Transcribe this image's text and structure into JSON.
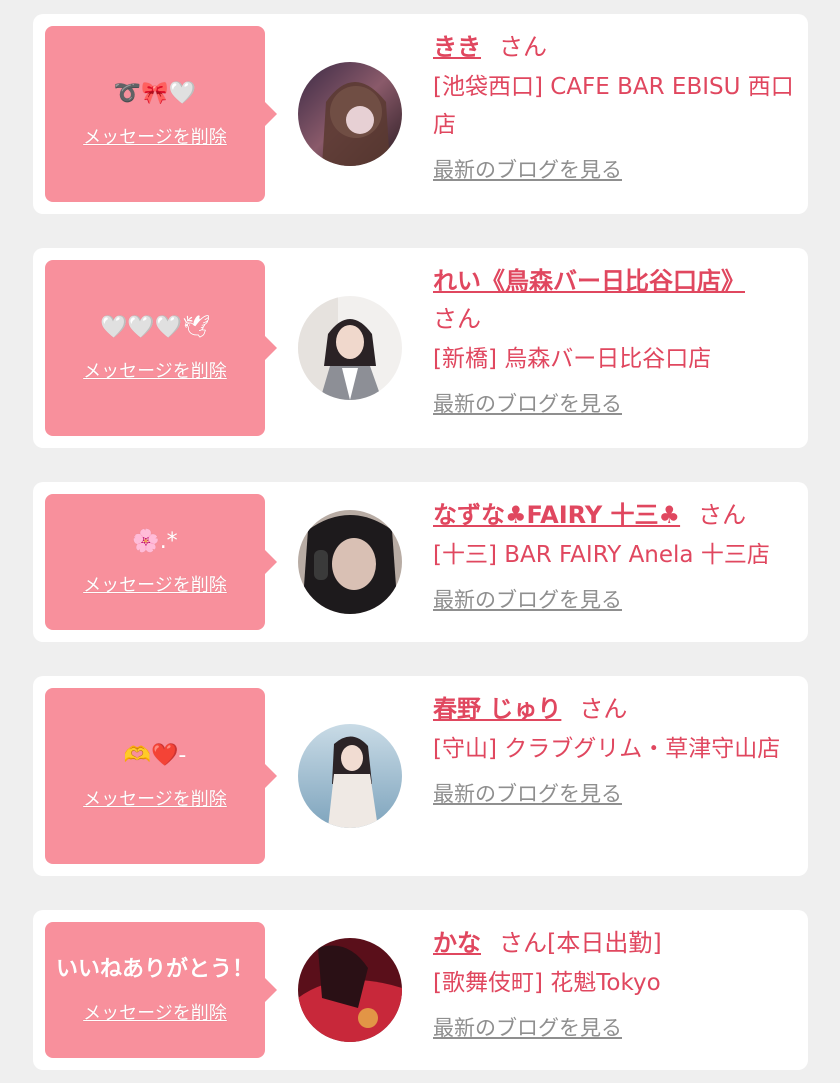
{
  "colors": {
    "accent": "#e0475f",
    "bubble": "#f8909c",
    "background": "#efefef",
    "link_gray": "#8f8f8f"
  },
  "delete_label": "メッセージを削除",
  "san_label": "さん",
  "blog_label": "最新のブログを見る",
  "items": [
    {
      "message": "➰🎀🤍",
      "name": "きき",
      "status": "",
      "shop": "[池袋西口] CAFE BAR EBISU 西口店"
    },
    {
      "message": "🤍🤍🤍🕊",
      "name": "れい《鳥森バー日比谷口店》",
      "status": "",
      "shop": "[新橋] 烏森バー日比谷口店"
    },
    {
      "message": "🌸.*",
      "name": "なずな♣FAIRY 十三♣",
      "status": "",
      "shop": "[十三] BAR FAIRY Anela 十三店"
    },
    {
      "message": "🫶❤️-",
      "name": "春野 じゅり",
      "status": "",
      "shop": "[守山] クラブグリム・草津守山店"
    },
    {
      "message": "いいねありがとう！",
      "name": "かな",
      "status": "[本日出勤]",
      "shop": "[歌舞伎町] 花魁Tokyo"
    }
  ]
}
